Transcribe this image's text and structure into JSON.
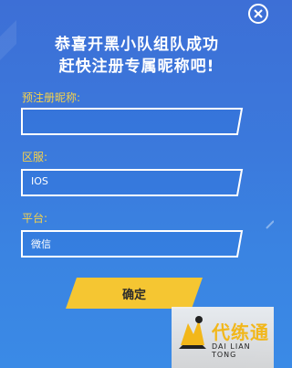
{
  "dialog": {
    "title_line1": "恭喜开黑小队组队成功",
    "title_line2": "赶快注册专属昵称吧!",
    "nickname": {
      "label": "预注册昵称:",
      "value": ""
    },
    "region": {
      "label": "区服:",
      "value": "IOS"
    },
    "platform": {
      "label": "平台:",
      "value": "微信"
    },
    "confirm_label": "确定"
  },
  "watermark": {
    "name": "代练通",
    "pinyin": "DAI LIAN TONG"
  },
  "colors": {
    "background": "#3b79dc",
    "label_yellow": "#f6d24a",
    "button_yellow": "#f5c632",
    "text_white": "#ffffff"
  },
  "icons": {
    "close": "close-icon",
    "logo": "daliantong-logo-icon"
  }
}
